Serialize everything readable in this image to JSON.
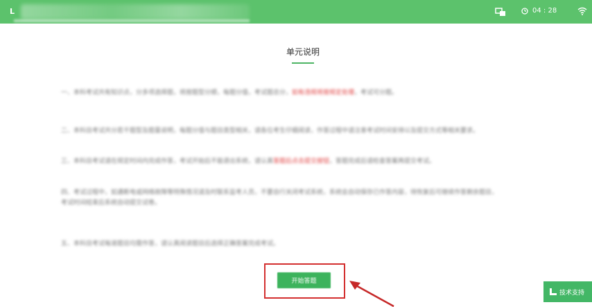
{
  "topbar": {
    "logo_text": "L",
    "timer": "04 : 28"
  },
  "title": "单元说明",
  "paragraphs": [
    {
      "text": "一、本科考试共有知识点，分多项选择题，将按题型分顺，每题分值，考试题总分，",
      "red": "如有违规将按规定处理",
      "tail": "，考试可分题。"
    },
    {
      "text": "二、本科目考试共分若干题型及题量说明，每题分值与题目类型相关，请各位考生仔细阅读，作答过程中请注意考试时间安排以及提交方式等相关要求。",
      "red": "",
      "tail": ""
    },
    {
      "text": "三、本科目考试请在规定时间内完成作答，考试开始后不能退出系统，请认真",
      "red": "答题后点击提交按钮",
      "tail": "，答题完成后请检查答案再提交考试。"
    },
    {
      "text": "四、考试过程中，如遇断电或网络故障等特殊情况请及时联系监考人员，不要自行关闭考试系统，系统会自动保存已作答内容，待恢复后可继续作答剩余题目，",
      "red": "",
      "tail": ""
    },
    {
      "text": "五、本科目考试每道题目均需作答，请认真阅读题目后选择正确答案完成考试。",
      "red": "",
      "tail": ""
    }
  ],
  "paragraph4_line2": "考试时间结束后系统自动提交试卷。",
  "start_button": "开始答题",
  "support_button": "技术支持"
}
